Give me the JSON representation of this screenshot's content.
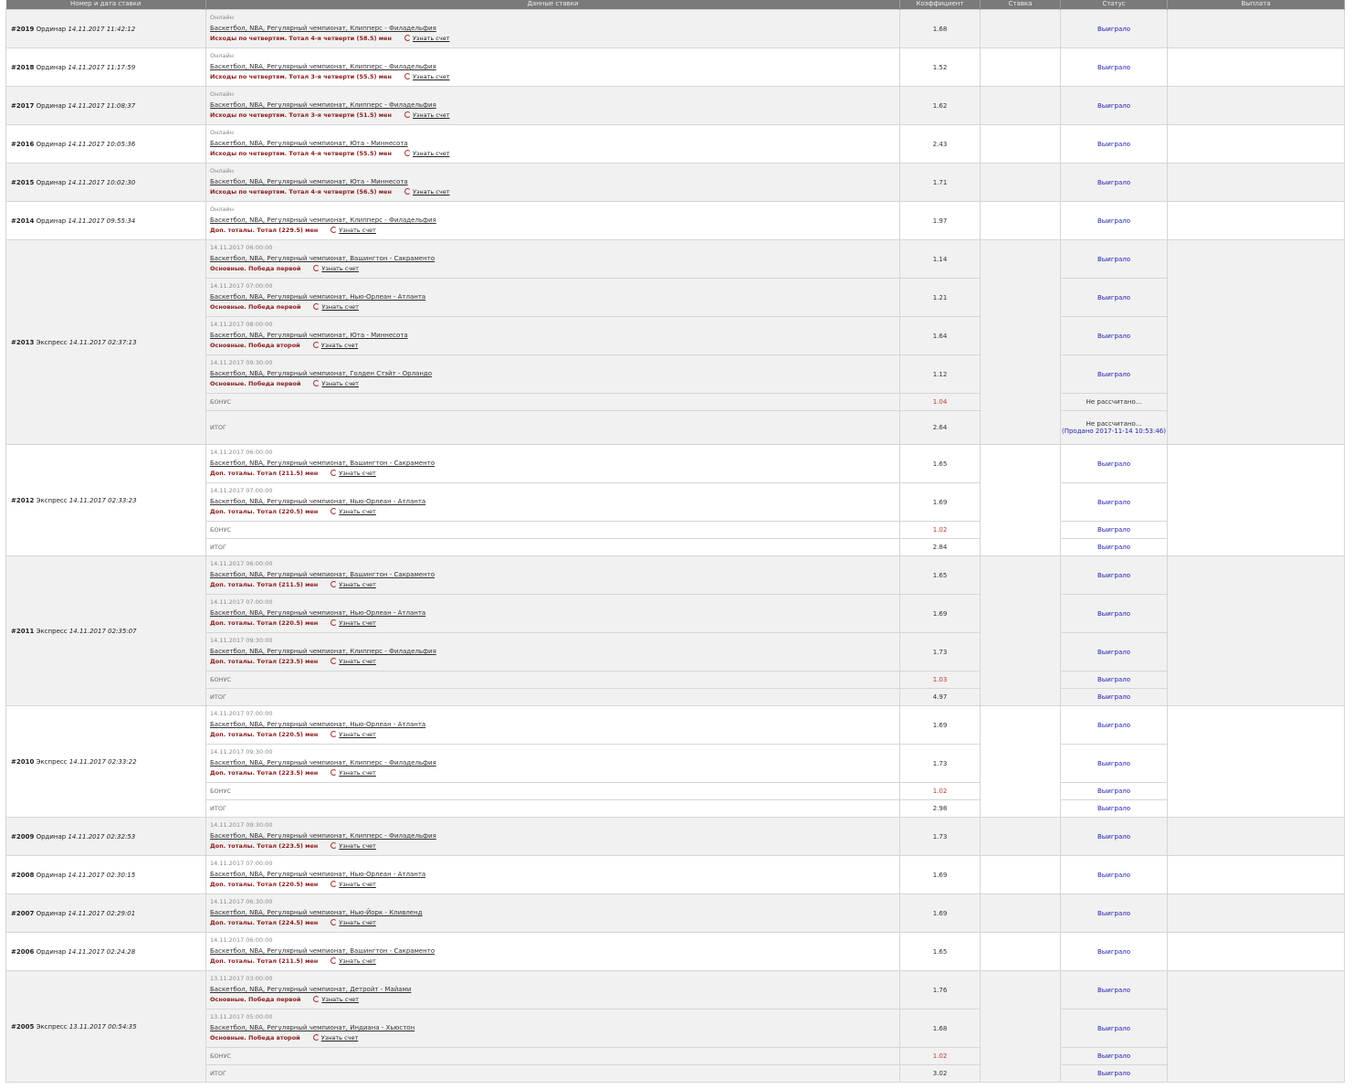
{
  "headers": [
    "Номер и дата ставки",
    "Данные ставки",
    "Коэффициент",
    "Ставка",
    "Статус",
    "Выплата"
  ],
  "labels": {
    "online": "Онлайн",
    "score": "Узнать счет",
    "bonus": "БОНУС",
    "total": "ИТОГ"
  },
  "bets": [
    {
      "num": "#2019",
      "type": "Ординар",
      "date": "14.11.2017 11:42:12",
      "rows": [
        {
          "sub": "Онлайн",
          "event": "Баскетбол, NBA, Регулярный чемпионат, Клипперс - Филадельфия",
          "outcome": "Исходы по четвертям. Тотал 4-я четверти (58.5) мен",
          "coef": "1.68",
          "status": "Выиграло"
        }
      ]
    },
    {
      "num": "#2018",
      "type": "Ординар",
      "date": "14.11.2017 11:17:59",
      "rows": [
        {
          "sub": "Онлайн",
          "event": "Баскетбол, NBA, Регулярный чемпионат, Клипперс - Филадельфия",
          "outcome": "Исходы по четвертям. Тотал 3-я четверти (55.5) мен",
          "coef": "1.52",
          "status": "Выиграло"
        }
      ]
    },
    {
      "num": "#2017",
      "type": "Ординар",
      "date": "14.11.2017 11:08:37",
      "rows": [
        {
          "sub": "Онлайн",
          "event": "Баскетбол, NBA, Регулярный чемпионат, Клипперс - Филадельфия",
          "outcome": "Исходы по четвертям. Тотал 3-я четверти (51.5) мен",
          "coef": "1.62",
          "status": "Выиграло"
        }
      ]
    },
    {
      "num": "#2016",
      "type": "Ординар",
      "date": "14.11.2017 10:05:36",
      "rows": [
        {
          "sub": "Онлайн",
          "event": "Баскетбол, NBA, Регулярный чемпионат, Юта - Миннесота",
          "outcome": "Исходы по четвертям. Тотал 4-я четверти (55.5) мен",
          "coef": "2.43",
          "status": "Выиграло"
        }
      ]
    },
    {
      "num": "#2015",
      "type": "Ординар",
      "date": "14.11.2017 10:02:30",
      "rows": [
        {
          "sub": "Онлайн",
          "event": "Баскетбол, NBA, Регулярный чемпионат, Юта - Миннесота",
          "outcome": "Исходы по четвертям. Тотал 4-я четверти (56.5) мен",
          "coef": "1.71",
          "status": "Выиграло"
        }
      ]
    },
    {
      "num": "#2014",
      "type": "Ординар",
      "date": "14.11.2017 09:55:34",
      "rows": [
        {
          "sub": "Онлайн",
          "event": "Баскетбол, NBA, Регулярный чемпионат, Клипперс - Филадельфия",
          "outcome": "Доп. тоталы. Тотал (229.5) мен",
          "coef": "1.97",
          "status": "Выиграло"
        }
      ]
    },
    {
      "num": "#2013",
      "type": "Экспресс",
      "date": "14.11.2017 02:37:13",
      "rows": [
        {
          "sub": "14.11.2017 06:00:00",
          "event": "Баскетбол, NBA, Регулярный чемпионат, Вашингтон - Сакраменто",
          "outcome": "Основные. Победа первой",
          "coef": "1.14",
          "status": "Выиграло"
        },
        {
          "sub": "14.11.2017 07:00:00",
          "event": "Баскетбол, NBA, Регулярный чемпионат, Нью-Орлеан - Атланта",
          "outcome": "Основные. Победа первой",
          "coef": "1.21",
          "status": "Выиграло"
        },
        {
          "sub": "14.11.2017 08:00:00",
          "event": "Баскетбол, NBA, Регулярный чемпионат, Юта - Миннесота",
          "outcome": "Основные. Победа второй",
          "coef": "1.64",
          "status": "Выиграло"
        },
        {
          "sub": "14.11.2017 09:30:00",
          "event": "Баскетбол, NBA, Регулярный чемпионат, Голден Стэйт - Орландо",
          "outcome": "Основные. Победа первой",
          "coef": "1.12",
          "status": "Выиграло"
        }
      ],
      "bonus": {
        "coef": "1.04",
        "status": "Не рассчитано..."
      },
      "total": {
        "coef": "2.64",
        "status": "Не рассчитано...",
        "sold": "(Продано 2017-11-14 10:53:46)"
      }
    },
    {
      "num": "#2012",
      "type": "Экспресс",
      "date": "14.11.2017 02:33:23",
      "rows": [
        {
          "sub": "14.11.2017 06:00:00",
          "event": "Баскетбол, NBA, Регулярный чемпионат, Вашингтон - Сакраменто",
          "outcome": "Доп. тоталы. Тотал (211.5) мен",
          "coef": "1.65",
          "status": "Выиграло"
        },
        {
          "sub": "14.11.2017 07:00:00",
          "event": "Баскетбол, NBA, Регулярный чемпионат, Нью-Орлеан - Атланта",
          "outcome": "Доп. тоталы. Тотал (220.5) мен",
          "coef": "1.69",
          "status": "Выиграло"
        }
      ],
      "bonus": {
        "coef": "1.02",
        "status": "Выиграло"
      },
      "total": {
        "coef": "2.84",
        "status": "Выиграло"
      }
    },
    {
      "num": "#2011",
      "type": "Экспресс",
      "date": "14.11.2017 02:35:07",
      "rows": [
        {
          "sub": "14.11.2017 06:00:00",
          "event": "Баскетбол, NBA, Регулярный чемпионат, Вашингтон - Сакраменто",
          "outcome": "Доп. тоталы. Тотал (211.5) мен",
          "coef": "1.65",
          "status": "Выиграло"
        },
        {
          "sub": "14.11.2017 07:00:00",
          "event": "Баскетбол, NBA, Регулярный чемпионат, Нью-Орлеан - Атланта",
          "outcome": "Доп. тоталы. Тотал (220.5) мен",
          "coef": "1.69",
          "status": "Выиграло"
        },
        {
          "sub": "14.11.2017 09:30:00",
          "event": "Баскетбол, NBA, Регулярный чемпионат, Клипперс - Филадельфия",
          "outcome": "Доп. тоталы. Тотал (223.5) мен",
          "coef": "1.73",
          "status": "Выиграло"
        }
      ],
      "bonus": {
        "coef": "1.03",
        "status": "Выиграло"
      },
      "total": {
        "coef": "4.97",
        "status": "Выиграло"
      }
    },
    {
      "num": "#2010",
      "type": "Экспресс",
      "date": "14.11.2017 02:33:22",
      "rows": [
        {
          "sub": "14.11.2017 07:00:00",
          "event": "Баскетбол, NBA, Регулярный чемпионат, Нью-Орлеан - Атланта",
          "outcome": "Доп. тоталы. Тотал (220.5) мен",
          "coef": "1.69",
          "status": "Выиграло"
        },
        {
          "sub": "14.11.2017 09:30:00",
          "event": "Баскетбол, NBA, Регулярный чемпионат, Клипперс - Филадельфия",
          "outcome": "Доп. тоталы. Тотал (223.5) мен",
          "coef": "1.73",
          "status": "Выиграло"
        }
      ],
      "bonus": {
        "coef": "1.02",
        "status": "Выиграло"
      },
      "total": {
        "coef": "2.98",
        "status": "Выиграло"
      }
    },
    {
      "num": "#2009",
      "type": "Ординар",
      "date": "14.11.2017 02:32:53",
      "rows": [
        {
          "sub": "14.11.2017 09:30:00",
          "event": "Баскетбол, NBA, Регулярный чемпионат, Клипперс - Филадельфия",
          "outcome": "Доп. тоталы. Тотал (223.5) мен",
          "coef": "1.73",
          "status": "Выиграло"
        }
      ]
    },
    {
      "num": "#2008",
      "type": "Ординар",
      "date": "14.11.2017 02:30:15",
      "rows": [
        {
          "sub": "14.11.2017 07:00:00",
          "event": "Баскетбол, NBA, Регулярный чемпионат, Нью-Орлеан - Атланта",
          "outcome": "Доп. тоталы. Тотал (220.5) мен",
          "coef": "1.69",
          "status": "Выиграло"
        }
      ]
    },
    {
      "num": "#2007",
      "type": "Ординар",
      "date": "14.11.2017 02:29:01",
      "rows": [
        {
          "sub": "14.11.2017 06:30:00",
          "event": "Баскетбол, NBA, Регулярный чемпионат, Нью-Йорк - Кливленд",
          "outcome": "Доп. тоталы. Тотал (224.5) мен",
          "coef": "1.69",
          "status": "Выиграло"
        }
      ]
    },
    {
      "num": "#2006",
      "type": "Ординар",
      "date": "14.11.2017 02:24:28",
      "rows": [
        {
          "sub": "14.11.2017 06:00:00",
          "event": "Баскетбол, NBA, Регулярный чемпионат, Вашингтон - Сакраменто",
          "outcome": "Доп. тоталы. Тотал (211.5) мен",
          "coef": "1.65",
          "status": "Выиграло"
        }
      ]
    },
    {
      "num": "#2005",
      "type": "Экспресс",
      "date": "13.11.2017 00:54:35",
      "rows": [
        {
          "sub": "13.11.2017 03:00:00",
          "event": "Баскетбол, NBA, Регулярный чемпионат, Детройт - Майами",
          "outcome": "Основные. Победа первой",
          "coef": "1.76",
          "status": "Выиграло"
        },
        {
          "sub": "13.11.2017 05:00:00",
          "event": "Баскетбол, NBA, Регулярный чемпионат, Индиана - Хьюстон",
          "outcome": "Основные. Победа второй",
          "coef": "1.68",
          "status": "Выиграло"
        }
      ],
      "bonus": {
        "coef": "1.02",
        "status": "Выиграло"
      },
      "total": {
        "coef": "3.02",
        "status": "Выиграло"
      }
    }
  ]
}
